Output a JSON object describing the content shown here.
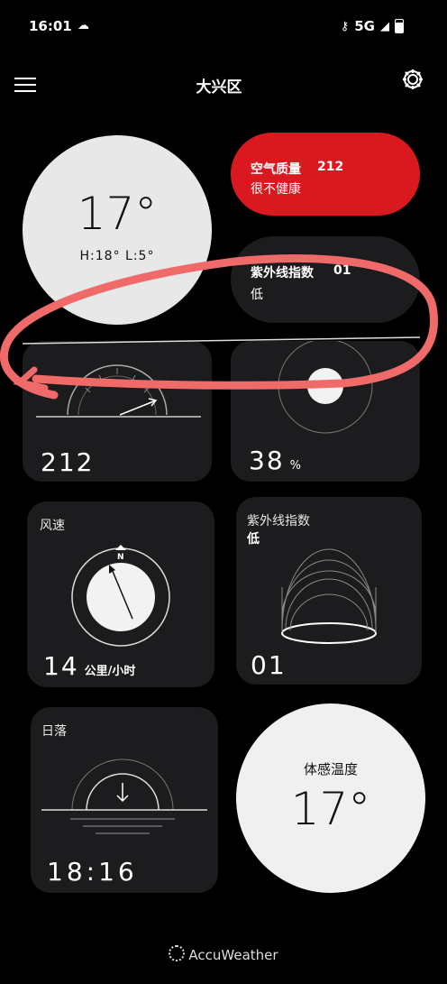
{
  "status": {
    "time": "16:01",
    "network": "5G"
  },
  "header": {
    "title": "大兴区"
  },
  "temp_card": {
    "temp": "17°",
    "hilo": "H:18° L:5°"
  },
  "aqi_card": {
    "label": "空气质量",
    "value": "212",
    "desc": "很不健康",
    "accent": "#d9191f"
  },
  "uv_small": {
    "label": "紫外线指数",
    "value": "01",
    "desc": "低"
  },
  "aqi_gauge": {
    "value": "212"
  },
  "humidity": {
    "value": "38",
    "unit": "%"
  },
  "wind": {
    "label": "风速",
    "value": "14",
    "unit": "公里/小时",
    "compass_n": "N"
  },
  "uv_card": {
    "label": "紫外线指数",
    "desc": "低",
    "value": "01"
  },
  "sunset": {
    "label": "日落",
    "time": "18:16"
  },
  "feels": {
    "label": "体感温度",
    "value": "17°"
  },
  "footer": {
    "brand": "AccuWeather"
  },
  "colors": {
    "annotation": "#f06a6a",
    "aqi": "#d9191f"
  }
}
